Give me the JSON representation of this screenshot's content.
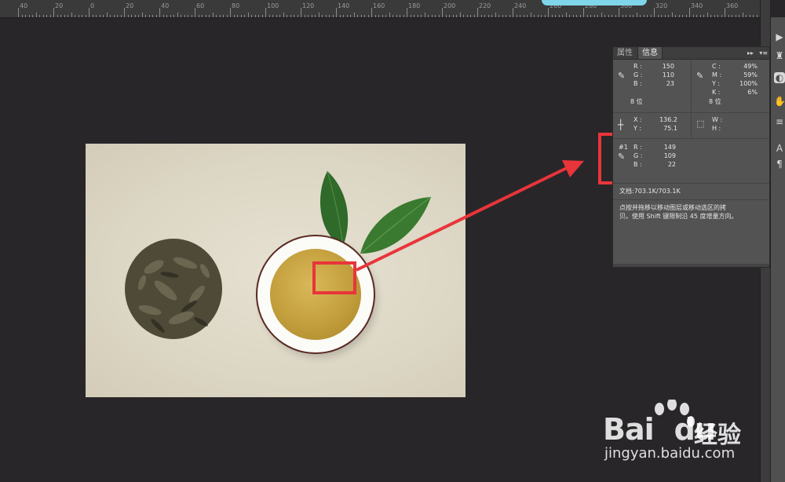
{
  "ruler": {
    "labels": [
      "40",
      "20",
      "0",
      "20",
      "40",
      "60",
      "80",
      "100",
      "120",
      "140",
      "160",
      "180",
      "200",
      "220",
      "240",
      "260",
      "280",
      "300",
      "320",
      "340",
      "360"
    ]
  },
  "panel": {
    "tabs": [
      "属性",
      "信息"
    ],
    "active_tab": "信息",
    "ctrl_glyph": "▸▸",
    "menu_glyph": "▾≡",
    "rgb": {
      "r_label": "R :",
      "g_label": "G :",
      "b_label": "B :",
      "r": "150",
      "g": "110",
      "b": "23",
      "bit": "8 位"
    },
    "cmyk": {
      "c_label": "C :",
      "m_label": "M :",
      "y_label": "Y :",
      "k_label": "K :",
      "c": "49%",
      "m": "59%",
      "y": "100%",
      "k": "6%",
      "bit": "8 位"
    },
    "position": {
      "x_label": "X :",
      "y_label": "Y :",
      "x": "136.2",
      "y": "75.1",
      "w_label": "W :",
      "h_label": "H :"
    },
    "sampler": {
      "id": "#1",
      "r_label": "R :",
      "g_label": "G :",
      "b_label": "B :",
      "r": "149",
      "g": "109",
      "b": "22"
    },
    "doc": "文档:703.1K/703.1K",
    "hint_line1": "点按并拖移以移动图层或移动选区的拷",
    "hint_line2": "贝。使用 Shift 键限制沿 45 度增量方向。"
  },
  "watermark": {
    "brand": "Bai",
    "brand2": "du",
    "product": "经验",
    "url": "jingyan.baidu.com"
  },
  "colors": {
    "annotation": "#e8353a",
    "panel_bg": "#535353",
    "canvas_bg": "#282629"
  },
  "icons": [
    "eyedropper-icon",
    "crosshair-icon",
    "selection-size-icon",
    "sampler-eyedropper-icon",
    "panel-menu-icon"
  ]
}
